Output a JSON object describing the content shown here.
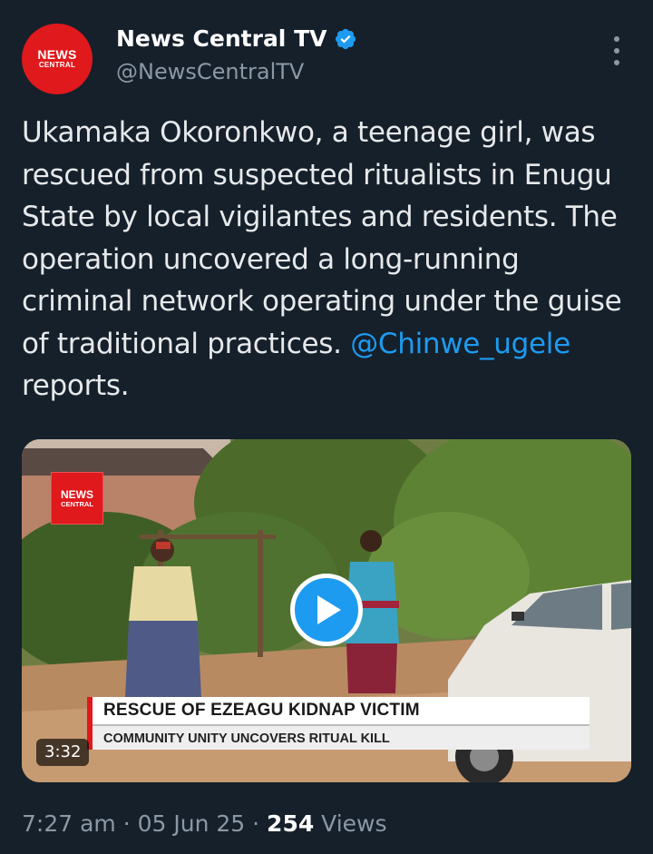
{
  "account": {
    "display_name": "News Central TV",
    "handle": "@NewsCentralTV",
    "avatar_line1": "NEWS",
    "avatar_line2": "CENTRAL",
    "verified_icon": "verified-badge-icon"
  },
  "tweet": {
    "text_part1": "Ukamaka Okoronkwo, a teenage girl, was rescued from suspected ritualists in Enugu State by local vigilantes and residents. The operation uncovered a long-running criminal network operating under the guise of traditional practices.",
    "mention": "@Chinwe_ugele",
    "text_part2": " reports."
  },
  "video": {
    "logo_line1": "NEWS",
    "logo_line2": "CENTRAL",
    "headline": "RESCUE OF EZEAGU KIDNAP VICTIM",
    "subheadline": "COMMUNITY UNITY UNCOVERS RITUAL KILL",
    "duration": "3:32",
    "play_icon": "play-icon"
  },
  "meta": {
    "time": "7:27 am",
    "separator": " · ",
    "date": "05 Jun 25",
    "views_count": "254",
    "views_label": " Views"
  },
  "colors": {
    "background": "#15202b",
    "accent": "#1d9bf0",
    "brand_red": "#e0191c",
    "secondary_text": "#8b98a5"
  }
}
